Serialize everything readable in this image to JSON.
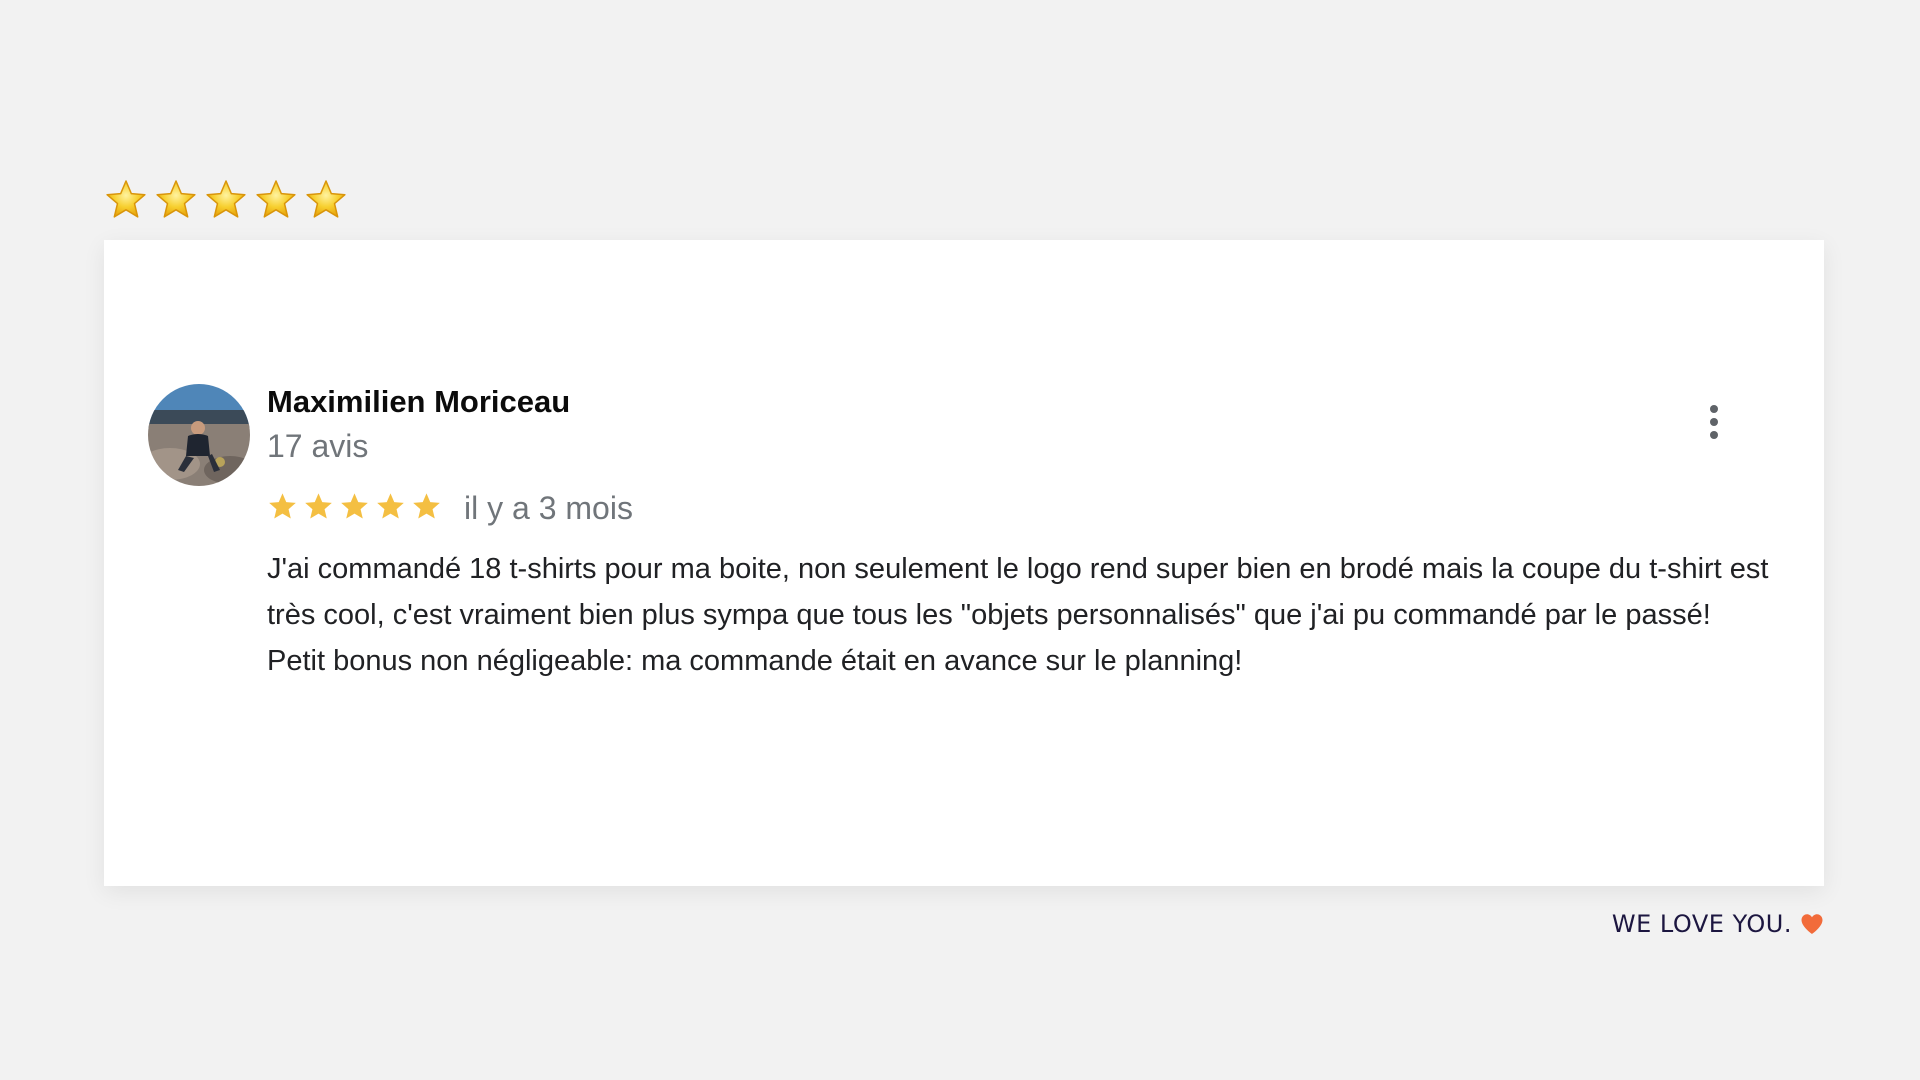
{
  "top_rating": {
    "stars": 5,
    "icon": "star-emoji-icon",
    "color": "#f5c518"
  },
  "review": {
    "author_name": "Maximilien Moriceau",
    "review_count": "17 avis",
    "rating": 5,
    "star_color": "#f4bf42",
    "date": "il y a 3 mois",
    "text_lines": [
      "J'ai commandé 18 t-shirts pour ma boite, non seulement le logo rend super bien en brodé mais la coupe du t-shirt est très cool, c'est vraiment bien plus sympa que tous les \"objets personnalisés\" que j'ai pu commandé par le passé!",
      "Petit bonus non négligeable: ma commande était en avance sur le planning!"
    ],
    "more_icon": "more-vertical-icon"
  },
  "footer": {
    "tagline": "WE LOVE YOU.",
    "heart_icon": "heart-icon",
    "heart_color": "#f26b3a"
  }
}
